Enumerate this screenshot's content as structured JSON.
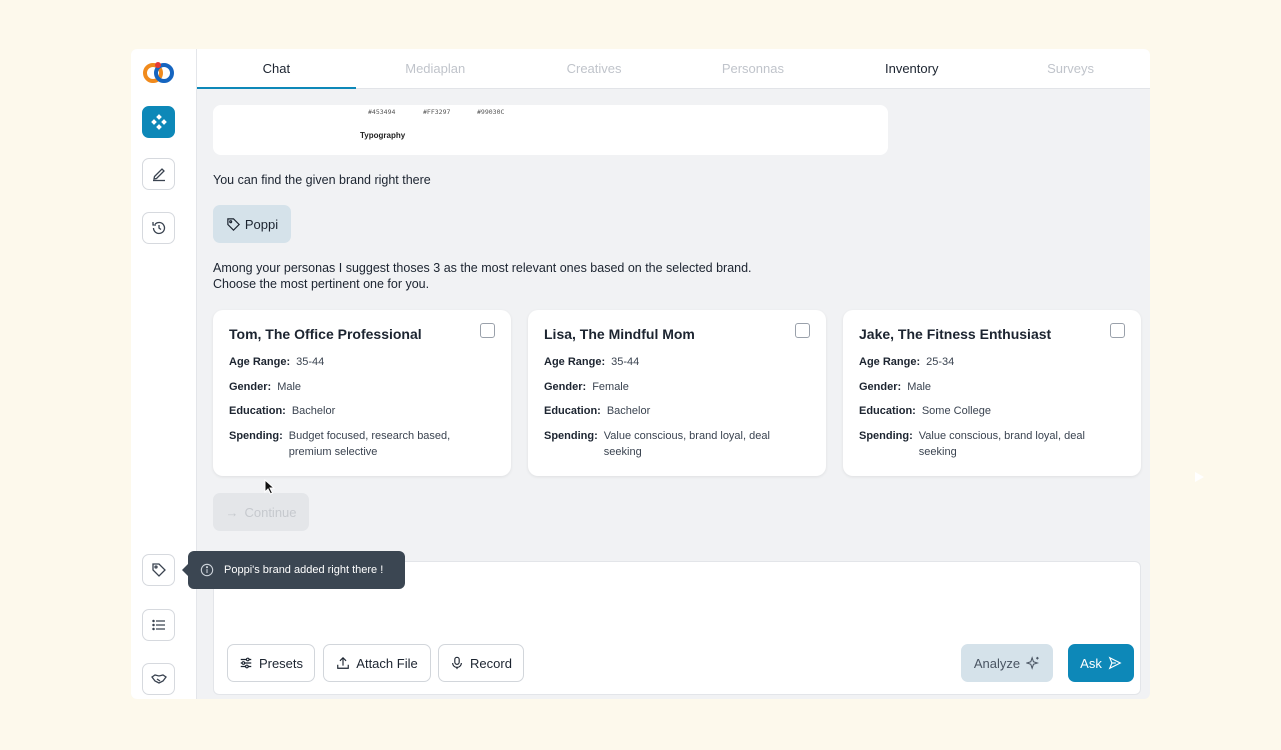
{
  "colors": {
    "accent": "#0d88b8",
    "page_bg": "#fdf9ec",
    "app_bg": "#f1f2f4",
    "tooltip_bg": "#3b4652",
    "chip_bg": "#d5e2ea"
  },
  "tabs": [
    {
      "label": "Chat",
      "state": "active"
    },
    {
      "label": "Mediaplan",
      "state": "disabled"
    },
    {
      "label": "Creatives",
      "state": "disabled"
    },
    {
      "label": "Personnas",
      "state": "disabled"
    },
    {
      "label": "Inventory",
      "state": "enabled"
    },
    {
      "label": "Surveys",
      "state": "disabled"
    }
  ],
  "sidebar": {
    "top_icons": [
      "sparkle-grid-icon",
      "edit-icon",
      "history-icon"
    ],
    "bottom_icons": [
      "tag-icon",
      "list-icon",
      "handshake-icon"
    ]
  },
  "brand_card": {
    "hex_codes": [
      "#453494",
      "#FF3297",
      "#99030C"
    ],
    "typography_label": "Typography"
  },
  "messages": {
    "brand_found": "You can find the given brand right there",
    "brand_chip": "Poppi",
    "suggest_line1": "Among your personas I suggest thoses 3 as the most relevant ones based on the selected brand.",
    "suggest_line2": "Choose the most pertinent one for you."
  },
  "field_labels": {
    "age": "Age Range:",
    "gender": "Gender:",
    "education": "Education:",
    "spending": "Spending:"
  },
  "personas": [
    {
      "name": "Tom, The Office Professional",
      "age": "35-44",
      "gender": "Male",
      "education": "Bachelor",
      "spending": "Budget focused, research based, premium selective"
    },
    {
      "name": "Lisa, The Mindful Mom",
      "age": "35-44",
      "gender": "Female",
      "education": "Bachelor",
      "spending": "Value conscious, brand loyal, deal seeking"
    },
    {
      "name": "Jake, The Fitness Enthusiast",
      "age": "25-34",
      "gender": "Male",
      "education": "Some College",
      "spending": "Value conscious, brand loyal, deal seeking"
    }
  ],
  "continue_label": "Continue",
  "tooltip_text": "Poppi's brand added right there !",
  "composer": {
    "presets_label": "Presets",
    "attach_label": "Attach File",
    "record_label": "Record",
    "analyze_label": "Analyze",
    "ask_label": "Ask"
  }
}
